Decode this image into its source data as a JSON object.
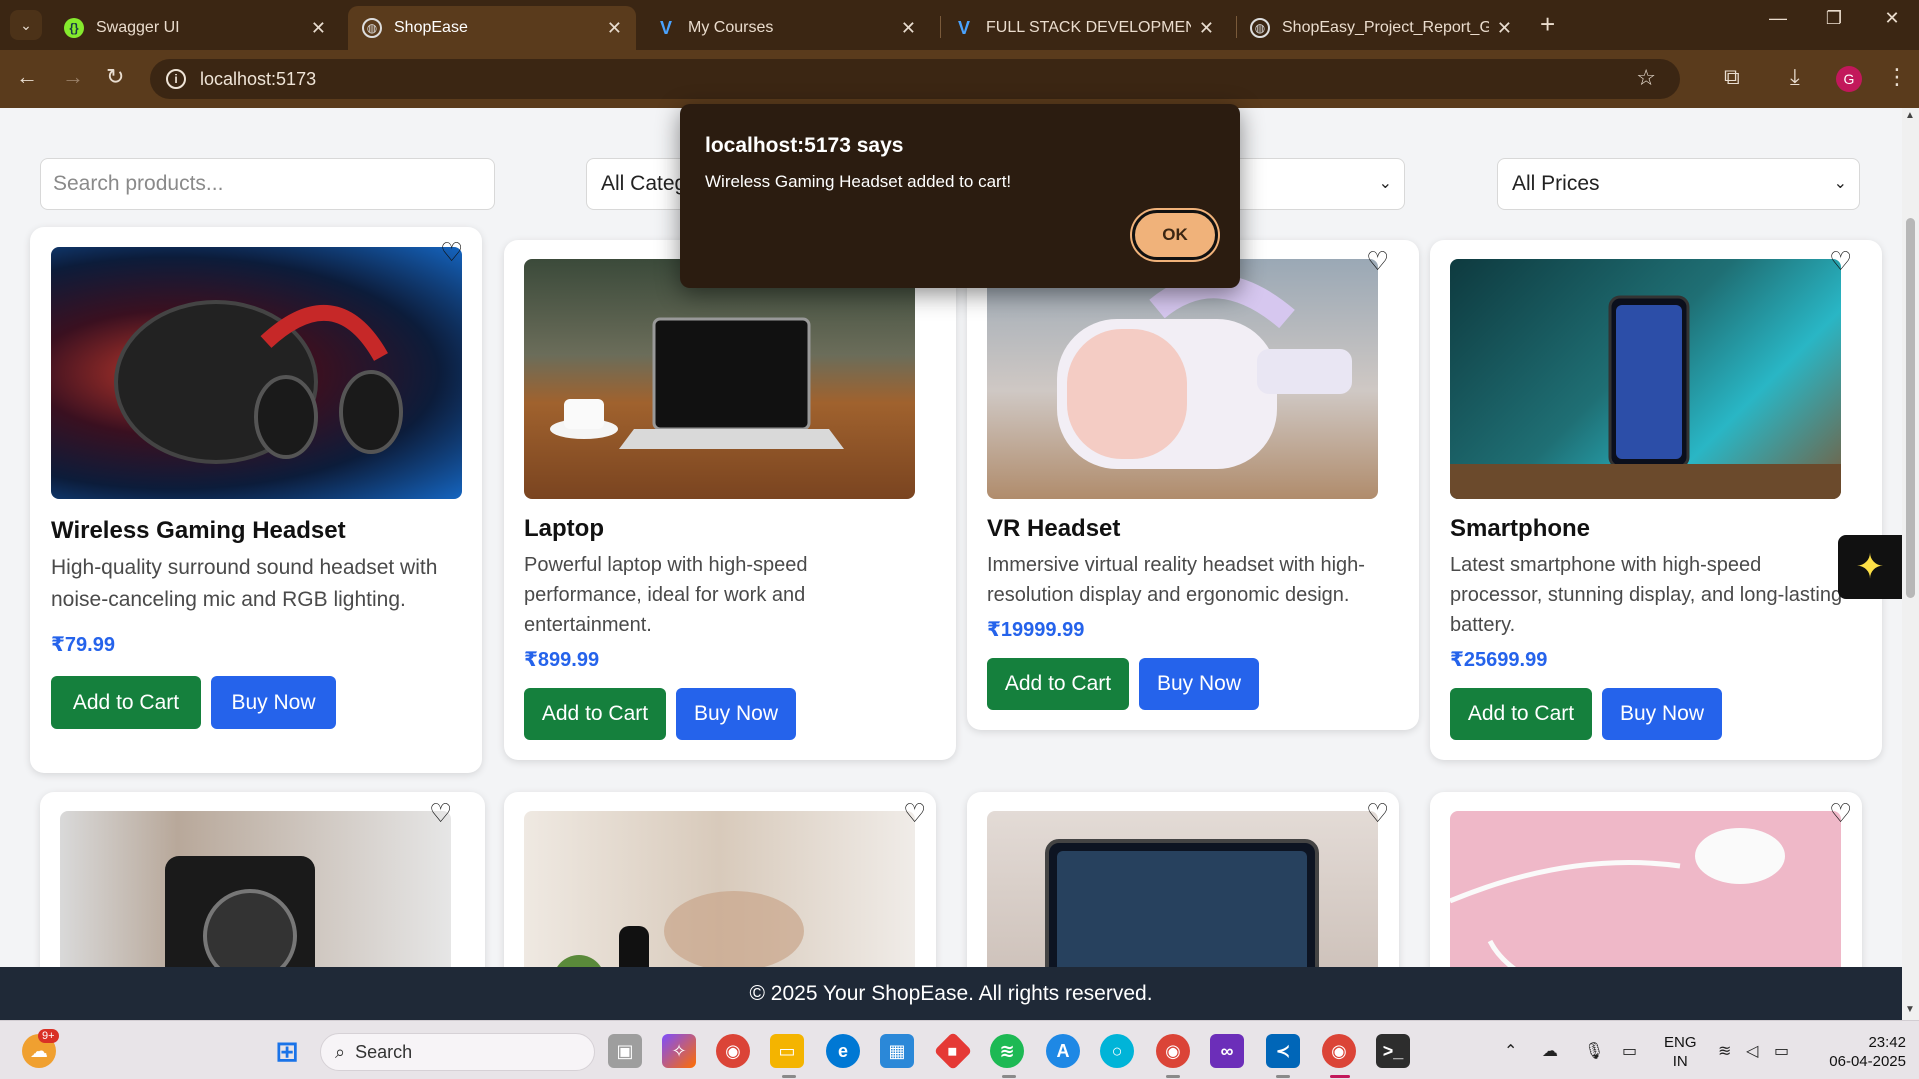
{
  "browser": {
    "tabs": [
      {
        "title": "Swagger UI",
        "favicon": "swagger-icon",
        "color": "#85ea2d"
      },
      {
        "title": "ShopEase",
        "favicon": "globe-icon",
        "active": true
      },
      {
        "title": "My Courses",
        "favicon": "courses-icon",
        "color": "#1e88e5"
      },
      {
        "title": "FULL STACK DEVELOPMENT - C",
        "favicon": "courses-icon",
        "color": "#1e88e5"
      },
      {
        "title": "ShopEasy_Project_Report_GRAC",
        "favicon": "globe-icon"
      }
    ],
    "url": "localhost:5173",
    "profile_initial": "G"
  },
  "filters": {
    "search_placeholder": "Search products...",
    "category_selected": "All Categ",
    "price_selected": "All Prices"
  },
  "products": [
    {
      "name": "Wireless Gaming Headset",
      "description": "High-quality surround sound headset with noise-canceling mic and RGB lighting.",
      "price": "₹79.99"
    },
    {
      "name": "Laptop",
      "description": "Powerful laptop with high-speed performance, ideal for work and entertainment.",
      "price": "₹899.99"
    },
    {
      "name": "VR Headset",
      "description": "Immersive virtual reality headset with high-resolution display and ergonomic design.",
      "price": "₹19999.99"
    },
    {
      "name": "Smartphone",
      "description": "Latest smartphone with high-speed processor, stunning display, and long-lasting battery.",
      "price": "₹25699.99"
    }
  ],
  "buttons": {
    "add_to_cart": "Add to Cart",
    "buy_now": "Buy Now"
  },
  "footer": {
    "text": "© 2025 Your ShopEase. All rights reserved."
  },
  "dialog": {
    "title": "localhost:5173 says",
    "message": "Wireless Gaming Headset added to cart!",
    "ok_label": "OK"
  },
  "taskbar": {
    "search_label": "Search",
    "weather_badge": "9+",
    "lang_line1": "ENG",
    "lang_line2": "IN",
    "time": "23:42",
    "date": "06-04-2025"
  },
  "colors": {
    "price_blue": "#2563eb",
    "add_to_cart_green": "#15803d",
    "buy_now_blue": "#2563eb",
    "browser_frame": "#5a3b1c",
    "footer_bg": "#1f2937"
  }
}
